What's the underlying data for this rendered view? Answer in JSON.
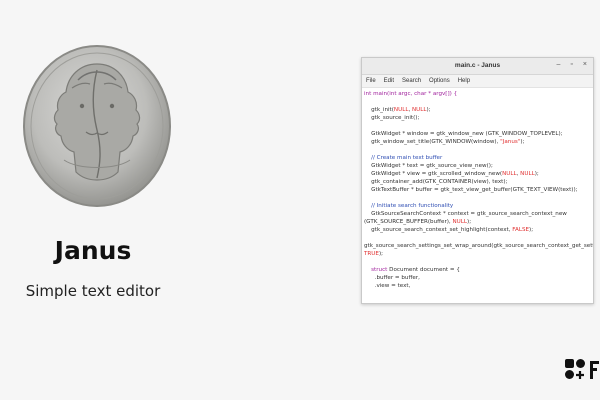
{
  "promo": {
    "app_name": "Janus",
    "subtitle": "Simple text editor",
    "coin_image": "janus-coin"
  },
  "window": {
    "title": "main.c - Janus",
    "controls": [
      "–",
      "▫",
      "×"
    ],
    "menu": [
      "File",
      "Edit",
      "Search",
      "Options",
      "Help"
    ]
  },
  "code_lines": [
    [
      {
        "t": "int main(int argc, char * argv[]) {",
        "c": "kw"
      }
    ],
    [
      {
        "t": "",
        "c": ""
      }
    ],
    [
      {
        "t": "    gtk_init(",
        "c": ""
      },
      {
        "t": "NULL",
        "c": "lit"
      },
      {
        "t": ", ",
        "c": ""
      },
      {
        "t": "NULL",
        "c": "lit"
      },
      {
        "t": ");",
        "c": ""
      }
    ],
    [
      {
        "t": "    gtk_source_init();",
        "c": ""
      }
    ],
    [
      {
        "t": "",
        "c": ""
      }
    ],
    [
      {
        "t": "    GtkWidget * window = gtk_window_new (GTK_WINDOW_TOPLEVEL);",
        "c": ""
      }
    ],
    [
      {
        "t": "    gtk_window_set_title(GTK_WINDOW(window), ",
        "c": ""
      },
      {
        "t": "\"Janus\"",
        "c": "lit"
      },
      {
        "t": ");",
        "c": ""
      }
    ],
    [
      {
        "t": "",
        "c": ""
      }
    ],
    [
      {
        "t": "    // Create main text buffer",
        "c": "cm"
      }
    ],
    [
      {
        "t": "    GtkWidget * text = gtk_source_view_new();",
        "c": ""
      }
    ],
    [
      {
        "t": "    GtkWidget * view = gtk_scrolled_window_new(",
        "c": ""
      },
      {
        "t": "NULL",
        "c": "lit"
      },
      {
        "t": ", ",
        "c": ""
      },
      {
        "t": "NULL",
        "c": "lit"
      },
      {
        "t": ");",
        "c": ""
      }
    ],
    [
      {
        "t": "    gtk_container_add(GTK_CONTAINER(view), text);",
        "c": ""
      }
    ],
    [
      {
        "t": "    GtkTextBuffer * buffer = gtk_text_view_get_buffer(GTK_TEXT_VIEW(text));",
        "c": ""
      }
    ],
    [
      {
        "t": "",
        "c": ""
      }
    ],
    [
      {
        "t": "    // Initiate search functionality",
        "c": "cm"
      }
    ],
    [
      {
        "t": "    GtkSourceSearchContext * context = gtk_source_search_context_new",
        "c": ""
      }
    ],
    [
      {
        "t": "(GTK_SOURCE_BUFFER(buffer), ",
        "c": ""
      },
      {
        "t": "NULL",
        "c": "lit"
      },
      {
        "t": ");",
        "c": ""
      }
    ],
    [
      {
        "t": "    gtk_source_search_context_set_highlight(context, ",
        "c": ""
      },
      {
        "t": "FALSE",
        "c": "lit"
      },
      {
        "t": ");",
        "c": ""
      }
    ],
    [
      {
        "t": "",
        "c": ""
      }
    ],
    [
      {
        "t": "gtk_source_search_settings_set_wrap_around(gtk_source_search_context_get_settin",
        "c": ""
      }
    ],
    [
      {
        "t": "TRUE",
        "c": "lit"
      },
      {
        "t": ");",
        "c": ""
      }
    ],
    [
      {
        "t": "",
        "c": ""
      }
    ],
    [
      {
        "t": "    ",
        "c": ""
      },
      {
        "t": "struct",
        "c": "kw"
      },
      {
        "t": " Document document = {",
        "c": ""
      }
    ],
    [
      {
        "t": "      .buffer = buffer,",
        "c": ""
      }
    ],
    [
      {
        "t": "      .view = text,",
        "c": ""
      }
    ]
  ],
  "colors": {
    "keyword": "#a0229d",
    "literal": "#e03030",
    "comment": "#2f4eb3",
    "background": "#f6f6f6"
  },
  "brand_logo": "brand-logo"
}
